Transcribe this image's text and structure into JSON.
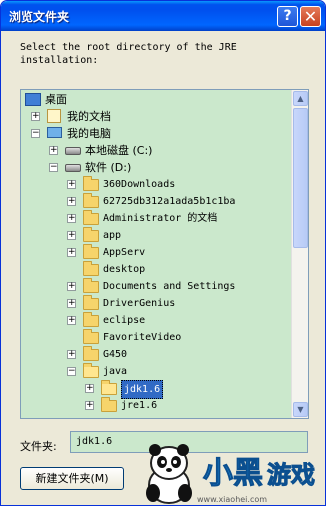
{
  "window": {
    "title": "浏览文件夹",
    "help_glyph": "?",
    "close_glyph": "✕"
  },
  "instruction": "Select the root directory of the JRE\ninstallation:",
  "tree": {
    "items": [
      {
        "label": "桌面",
        "icon": "desktop-icon",
        "expander": ""
      },
      {
        "label": "我的文档",
        "icon": "documents-icon",
        "expander": "+"
      },
      {
        "label": "我的电脑",
        "icon": "computer-icon",
        "expander": "−"
      },
      {
        "label": "本地磁盘 (C:)",
        "icon": "drive-icon",
        "expander": "+"
      },
      {
        "label": "软件 (D:)",
        "icon": "drive-icon",
        "expander": "−"
      },
      {
        "label": "360Downloads",
        "icon": "folder-icon",
        "expander": "+"
      },
      {
        "label": "62725db312a1ada5b1c1ba",
        "icon": "folder-icon",
        "expander": "+"
      },
      {
        "label": "Administrator 的文档",
        "icon": "folder-icon",
        "expander": "+"
      },
      {
        "label": "app",
        "icon": "folder-icon",
        "expander": "+"
      },
      {
        "label": "AppServ",
        "icon": "folder-icon",
        "expander": "+"
      },
      {
        "label": "desktop",
        "icon": "folder-icon",
        "expander": ""
      },
      {
        "label": "Documents and Settings",
        "icon": "folder-icon",
        "expander": "+"
      },
      {
        "label": "DriverGenius",
        "icon": "folder-icon",
        "expander": "+"
      },
      {
        "label": "eclipse",
        "icon": "folder-icon",
        "expander": "+"
      },
      {
        "label": "FavoriteVideo",
        "icon": "folder-icon",
        "expander": ""
      },
      {
        "label": "G450",
        "icon": "folder-icon",
        "expander": "+"
      },
      {
        "label": "java",
        "icon": "folder-open-icon",
        "expander": "−"
      },
      {
        "label": "jdk1.6",
        "icon": "folder-open-icon",
        "expander": "+"
      },
      {
        "label": "jre1.6",
        "icon": "folder-icon",
        "expander": "+"
      }
    ]
  },
  "scroll": {
    "up_glyph": "▲",
    "down_glyph": "▼"
  },
  "folder_field": {
    "label": "文件夹:",
    "value": "jdk1.6"
  },
  "buttons": {
    "new_folder": "新建文件夹(M)"
  },
  "watermark": {
    "logo_text": "小黑游戏",
    "url": "www.xiaohei.com"
  },
  "colors": {
    "tree_bg": "#cbe8cc",
    "title_blue": "#0053ee",
    "selection": "#316ac5"
  }
}
